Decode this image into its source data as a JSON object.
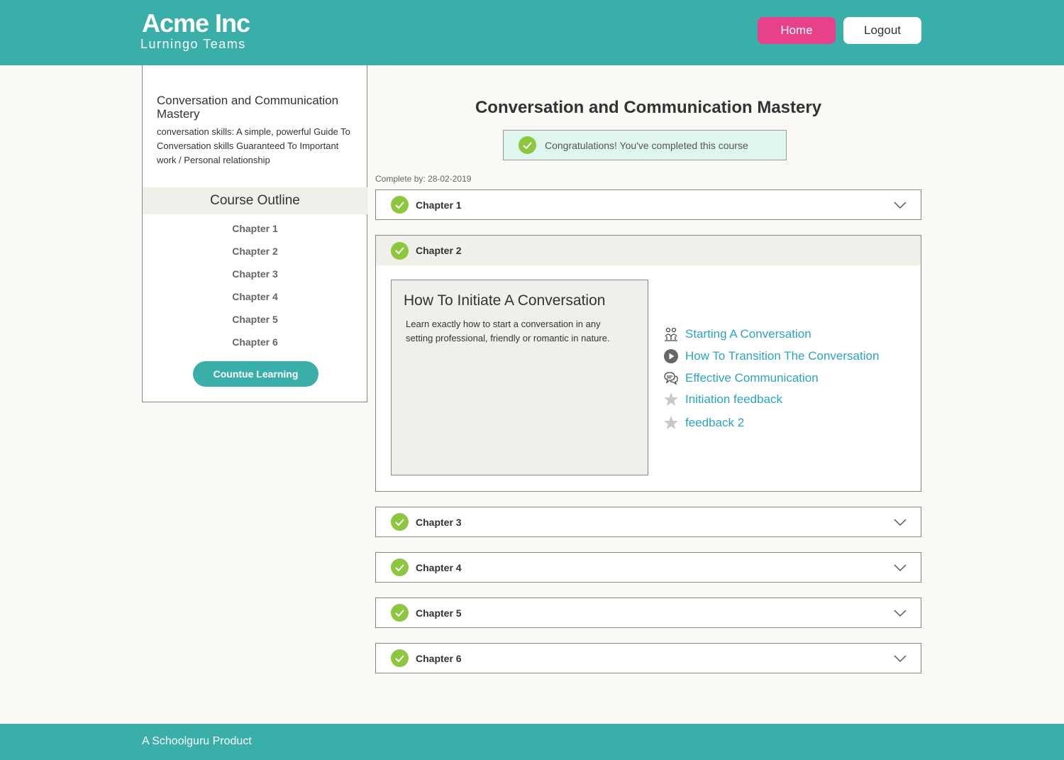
{
  "header": {
    "brand": "Acme Inc",
    "subbrand": "Lurningo Teams",
    "home_label": "Home",
    "logout_label": "Logout"
  },
  "sidebar": {
    "course_title": "Conversation and Communication Mastery",
    "course_description": "conversation skills: A simple, powerful Guide To Conversation skills Guaranteed To Important work / Personal relationship",
    "outline_heading": "Course Outline",
    "chapters": [
      "Chapter 1",
      "Chapter 2",
      "Chapter 3",
      "Chapter 4",
      "Chapter 5",
      "Chapter 6"
    ],
    "continue_label": "Countue Learning"
  },
  "main": {
    "title": "Conversation and Communication Mastery",
    "congrats_message": "Congratulations! You've completed this course",
    "complete_by": "Complete by: 28-02-2019",
    "chapters": [
      {
        "label": "Chapter 1",
        "completed": true,
        "expanded": false
      },
      {
        "label": "Chapter 2",
        "completed": true,
        "expanded": true
      },
      {
        "label": "Chapter 3",
        "completed": true,
        "expanded": false
      },
      {
        "label": "Chapter 4",
        "completed": true,
        "expanded": false
      },
      {
        "label": "Chapter 5",
        "completed": true,
        "expanded": false
      },
      {
        "label": "Chapter 6",
        "completed": true,
        "expanded": false
      }
    ],
    "lesson": {
      "title": "How To Initiate A Conversation",
      "description": "Learn exactly how to start a conversation in any setting professional, friendly or romantic in nature."
    },
    "activities": [
      {
        "label": "Starting A Conversation",
        "icon": "people-icon"
      },
      {
        "label": "How To Transition The Conversation",
        "icon": "play-icon"
      },
      {
        "label": "Effective Communication",
        "icon": "chat-bubbles-icon"
      },
      {
        "label": "Initiation feedback",
        "icon": "star-icon"
      },
      {
        "label": "feedback 2",
        "icon": "star-icon"
      }
    ]
  },
  "footer": {
    "text": "A Schoolguru Product"
  },
  "colors": {
    "teal": "#3aafa9",
    "pink": "#e8418c",
    "check_green": "#8dc63f",
    "link_blue": "#2ba3c4",
    "congrats_bg": "#def6ee"
  }
}
